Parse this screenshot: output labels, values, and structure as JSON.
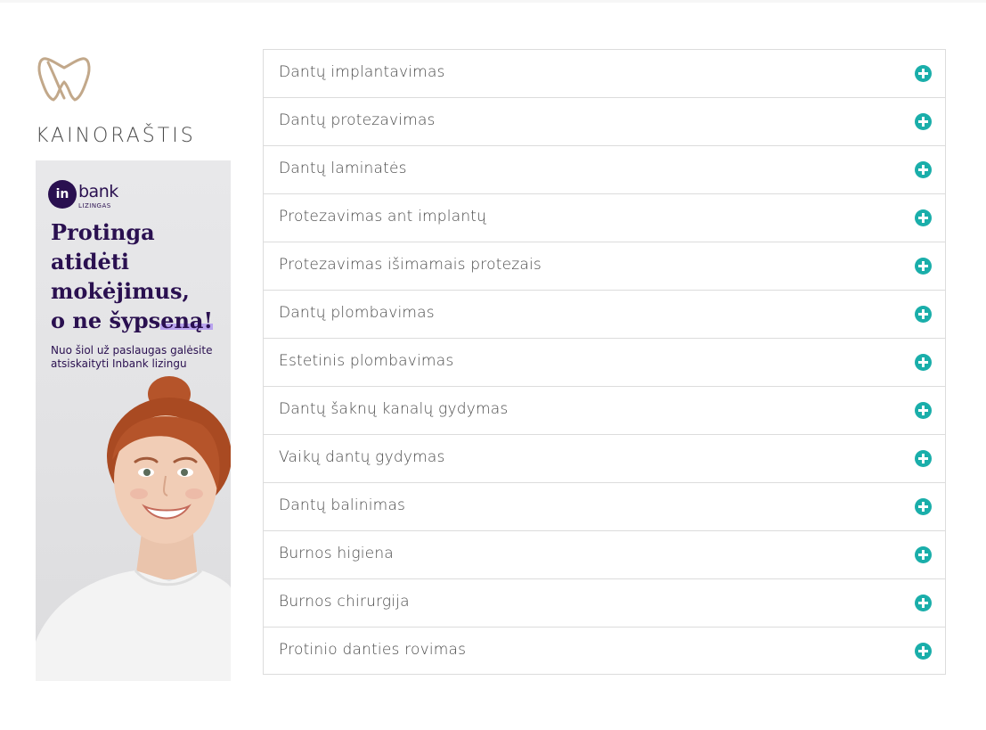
{
  "sidebar": {
    "title": "KAINORAŠTIS",
    "logo_icon": "tooth-outline-icon",
    "logo_color": "#c2a88a"
  },
  "banner": {
    "brand_mark": "in",
    "brand_name": "bank",
    "brand_sub": "LIZINGAS",
    "headline_lines": [
      "Protinga",
      "atidėti",
      "mokėjimus,",
      "o ne šypseną!"
    ],
    "headline_plain": "o ne šyps",
    "headline_marked": "eną!",
    "subtext": "Nuo šiol už paslaugas galėsite atsiskaityti Inbank lizingu",
    "brand_color": "#2a1050"
  },
  "accordion": {
    "icon": "plus-circle-icon",
    "accent_color": "#1aaeaa",
    "items": [
      {
        "label": "Dantų implantavimas"
      },
      {
        "label": "Dantų protezavimas"
      },
      {
        "label": "Dantų laminatės"
      },
      {
        "label": "Protezavimas ant implantų"
      },
      {
        "label": "Protezavimas išimamais protezais"
      },
      {
        "label": "Dantų plombavimas"
      },
      {
        "label": "Estetinis plombavimas"
      },
      {
        "label": "Dantų šaknų kanalų gydymas"
      },
      {
        "label": "Vaikų dantų gydymas"
      },
      {
        "label": "Dantų balinimas"
      },
      {
        "label": "Burnos higiena"
      },
      {
        "label": "Burnos chirurgija"
      },
      {
        "label": "Protinio danties rovimas"
      }
    ]
  }
}
